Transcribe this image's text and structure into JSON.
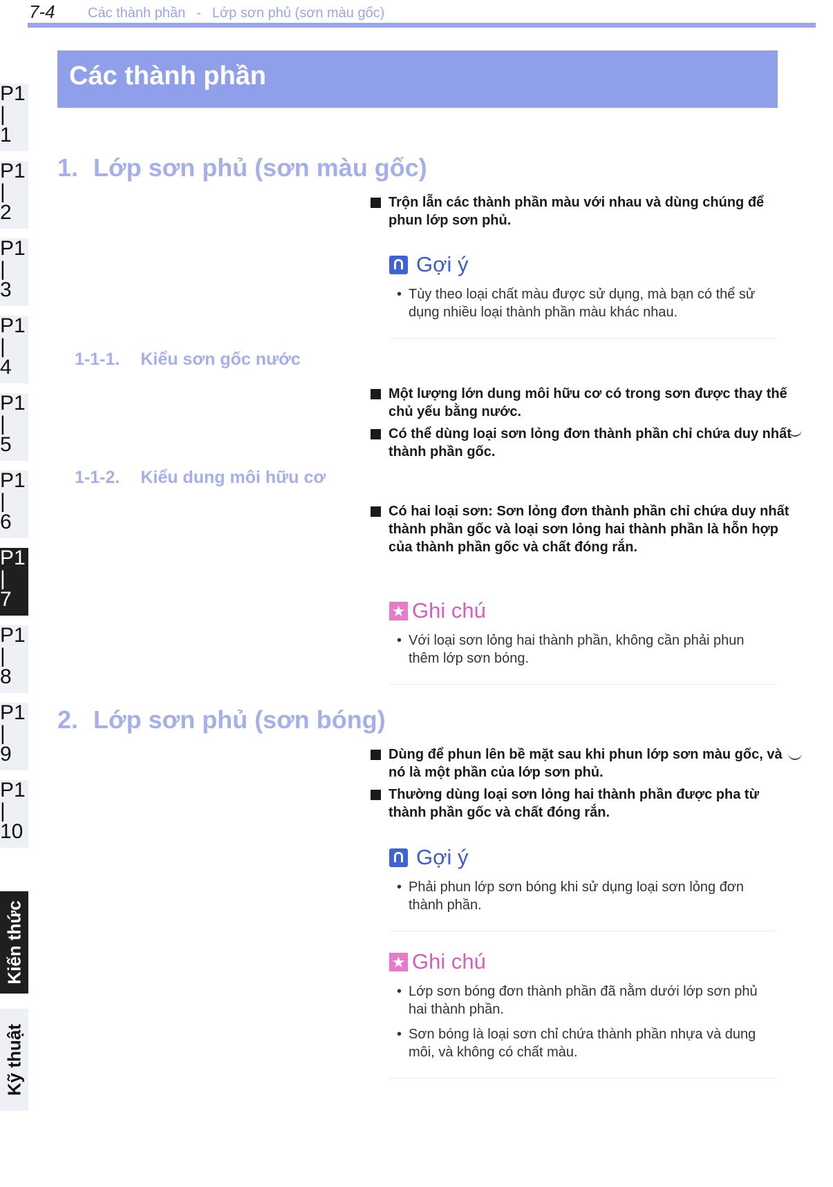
{
  "header": {
    "page_number": "7-4",
    "breadcrumb_1": "Các thành phần",
    "separator": "-",
    "breadcrumb_2": "Lớp sơn phủ (sơn màu gốc)"
  },
  "side_tabs": [
    {
      "top": "P1",
      "mid": "|",
      "bottom": "1"
    },
    {
      "top": "P1",
      "mid": "|",
      "bottom": "2"
    },
    {
      "top": "P1",
      "mid": "|",
      "bottom": "3"
    },
    {
      "top": "P1",
      "mid": "|",
      "bottom": "4"
    },
    {
      "top": "P1",
      "mid": "|",
      "bottom": "5"
    },
    {
      "top": "P1",
      "mid": "|",
      "bottom": "6"
    },
    {
      "top": "P1",
      "mid": "|",
      "bottom": "7"
    },
    {
      "top": "P1",
      "mid": "|",
      "bottom": "8"
    },
    {
      "top": "P1",
      "mid": "|",
      "bottom": "9"
    },
    {
      "top": "P1",
      "mid": "|",
      "bottom": "10"
    }
  ],
  "vertical_tabs": {
    "knowledge": "Kiến thức",
    "technique": "Kỹ thuật"
  },
  "banner_title": "Các thành phần",
  "section1": {
    "number": "1.",
    "title": "Lớp sơn phủ (sơn màu gốc)",
    "bullet": "Trộn lẫn các thành phần màu với nhau và dùng chúng để phun lớp sơn phủ.",
    "hint": {
      "title": "Gợi ý",
      "item": "Tùy theo loại chất màu được sử dụng, mà bạn có thể sử dụng nhiều loại thành phần màu khác nhau."
    },
    "sub1": {
      "number": "1-1-1.",
      "title": "Kiểu sơn gốc nước",
      "bullet1": "Một lượng lớn dung môi hữu cơ có trong sơn được thay thế chủ yếu bằng nước.",
      "bullet2": "Có thể dùng loại sơn lỏng đơn thành phần chỉ chứa duy nhất thành phần gốc."
    },
    "sub2": {
      "number": "1-1-2.",
      "title": "Kiểu dung môi hữu cơ",
      "bullet": "Có hai loại sơn: Sơn lỏng đơn thành phần chỉ chứa duy nhất thành phần gốc và loại sơn lỏng hai thành phần là hỗn hợp của thành phần gốc và chất đóng rắn."
    },
    "note": {
      "title": "Ghi chú",
      "item": "Với loại sơn lỏng hai thành phần, không cần phải phun thêm lớp sơn bóng."
    }
  },
  "section2": {
    "number": "2.",
    "title": "Lớp sơn phủ (sơn bóng)",
    "bullet1": "Dùng để phun lên bề mặt sau khi phun lớp sơn màu gốc, và nó là một phần của lớp sơn phủ.",
    "bullet2": "Thường dùng loại sơn lỏng hai thành phần được pha từ thành phần gốc và chất đóng rắn.",
    "hint": {
      "title": "Gợi ý",
      "item": "Phải phun lớp sơn bóng khi sử dụng loại sơn lỏng đơn thành phần."
    },
    "note": {
      "title": "Ghi chú",
      "item1": "Lớp sơn bóng đơn thành phần đã nằm dưới lớp sơn phủ hai thành phần.",
      "item2": "Sơn bóng là loại sơn chỉ chứa thành phần nhựa và dung môi, và không có chất màu."
    }
  },
  "icons": {
    "hint": "lightbulb-icon",
    "note": "star-note-icon",
    "hint_color": "#3e63d6",
    "note_color": "#e57ccb",
    "accent": "#8f9fea"
  }
}
